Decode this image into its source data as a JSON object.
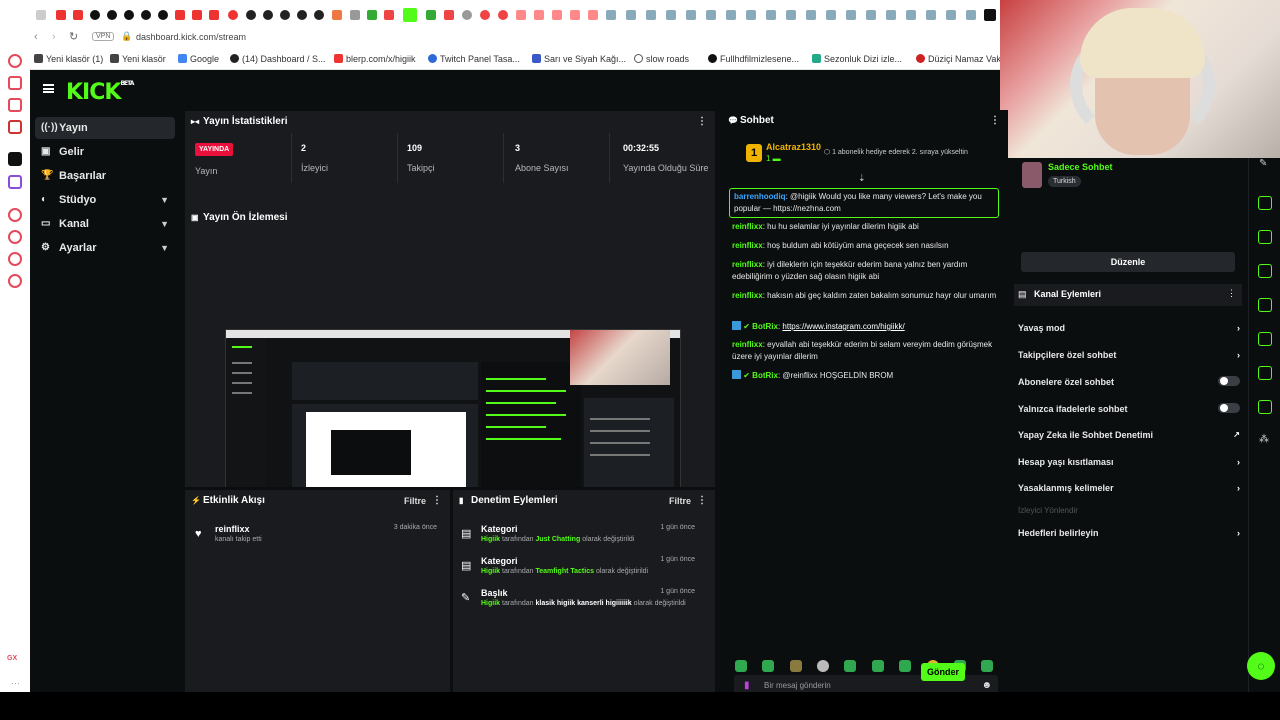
{
  "browser": {
    "url": "dashboard.kick.com/stream",
    "vpn": "VPN",
    "bookmarks": [
      "Yeni klasör (1)",
      "Yeni klasör",
      "Google",
      "(14) Dashboard / S...",
      "blerp.com/x/higiik",
      "Twitch Panel Tasa...",
      "Sarı ve Siyah Kağı...",
      "slow roads",
      "Fullhdfilmizlesene...",
      "Sezonluk Dizi izle...",
      "Düziçi Namaz Vak"
    ],
    "opera_bottom": "GX"
  },
  "logo": {
    "text": "KICK",
    "badge": "BETA"
  },
  "sidebar": {
    "items": [
      {
        "label": "Yayın",
        "icon": "((·))"
      },
      {
        "label": "Gelir",
        "icon": "▣"
      },
      {
        "label": "Başarılar",
        "icon": "🏆"
      },
      {
        "label": "Stüdyo",
        "icon": "◐"
      },
      {
        "label": "Kanal",
        "icon": "▭"
      },
      {
        "label": "Ayarlar",
        "icon": "⚙"
      }
    ]
  },
  "stats": {
    "title": "Yayın İstatistikleri",
    "live_badge": "YAYINDA",
    "live_label": "Yayın",
    "viewers": "2",
    "viewers_label": "İzleyici",
    "followers": "109",
    "followers_label": "Takipçi",
    "subs": "3",
    "subs_label": "Abone Sayısı",
    "uptime": "00:32:55",
    "uptime_label": "Yayında Olduğu Süre"
  },
  "preview": {
    "title": "Yayın Ön İzlemesi"
  },
  "activity": {
    "title": "Etkinlik Akışı",
    "filter": "Filtre",
    "item_user": "reinflixx",
    "item_desc": "kanalı takip etti",
    "item_time": "3 dakika önce"
  },
  "moderation": {
    "title": "Denetim Eylemleri",
    "filter": "Filtre",
    "items": [
      {
        "title": "Kategori",
        "user": "Higiik",
        "mid": "tarafından",
        "value": "Just Chatting",
        "tail": "olarak değiştirildi",
        "time": "1 gün önce"
      },
      {
        "title": "Kategori",
        "user": "Higiik",
        "mid": "tarafından",
        "value": "Teamfight Tactics",
        "tail": "olarak değiştirildi",
        "time": "1 gün önce"
      },
      {
        "title": "Başlık",
        "user": "Higiik",
        "mid": "tarafından",
        "value": "klasik higiik kanserli higiiiiiik",
        "tail": "olarak değiştirildi",
        "time": "1 gün önce"
      }
    ]
  },
  "chat": {
    "title": "Sohbet",
    "pinned_user": "Alcatraz1310",
    "pinned_text": "1 abonelik hediye ederek 2. sıraya yükseltin",
    "messages": [
      {
        "user": "barrenhoodiq",
        "text": "@higiik Would you like many viewers? Let's make you popular — https://nezhna.com"
      },
      {
        "user": "reinflixx",
        "text": "hu hu selamlar iyi yayınlar dilerim higiik abi"
      },
      {
        "user": "reinflixx",
        "text": "hoş buldum abi kötüyüm ama geçecek sen nasılsın"
      },
      {
        "user": "reinflixx",
        "text": "iyi dileklerin için teşekkür ederim bana yalnız ben yardım edebiliğirim o yüzden sağ olasın higiik abi"
      },
      {
        "user": "reinflixx",
        "text": "hakısın abi geç kaldım zaten bakalım sonumuz hayr olur umarım"
      },
      {
        "user": "BotRix",
        "text": "https://www.instagram.com/higiikk/"
      },
      {
        "user": "reinflixx",
        "text": "eyvallah abi teşekkür ederim bi selam vereyim dedim görüşmek üzere iyi yayınlar dilerim"
      },
      {
        "user": "BotRix",
        "text": "@reinflixx HOŞGELDİN BROM"
      }
    ],
    "input_placeholder": "Bir mesaj gönderin",
    "send": "Gönder"
  },
  "right_panel": {
    "chat_mode_title": "Sadece Sohbet",
    "chat_mode_tag": "Turkish",
    "edit": "Düzenle",
    "actions_title": "Kanal Eylemleri",
    "actions": [
      {
        "label": "Yavaş mod",
        "kind": "arrow"
      },
      {
        "label": "Takipçilere özel sohbet",
        "kind": "arrow"
      },
      {
        "label": "Abonelere özel sohbet",
        "kind": "toggle"
      },
      {
        "label": "Yalnızca ifadelerle sohbet",
        "kind": "toggle"
      },
      {
        "label": "Yapay Zeka ile Sohbet Denetimi",
        "kind": "ext"
      },
      {
        "label": "Hesap yaşı kısıtlaması",
        "kind": "arrow"
      },
      {
        "label": "Yasaklanmış kelimeler",
        "kind": "arrow"
      }
    ],
    "section_label": "İzleyici Yönlendir",
    "goals": "Hedefleri belirleyin"
  }
}
